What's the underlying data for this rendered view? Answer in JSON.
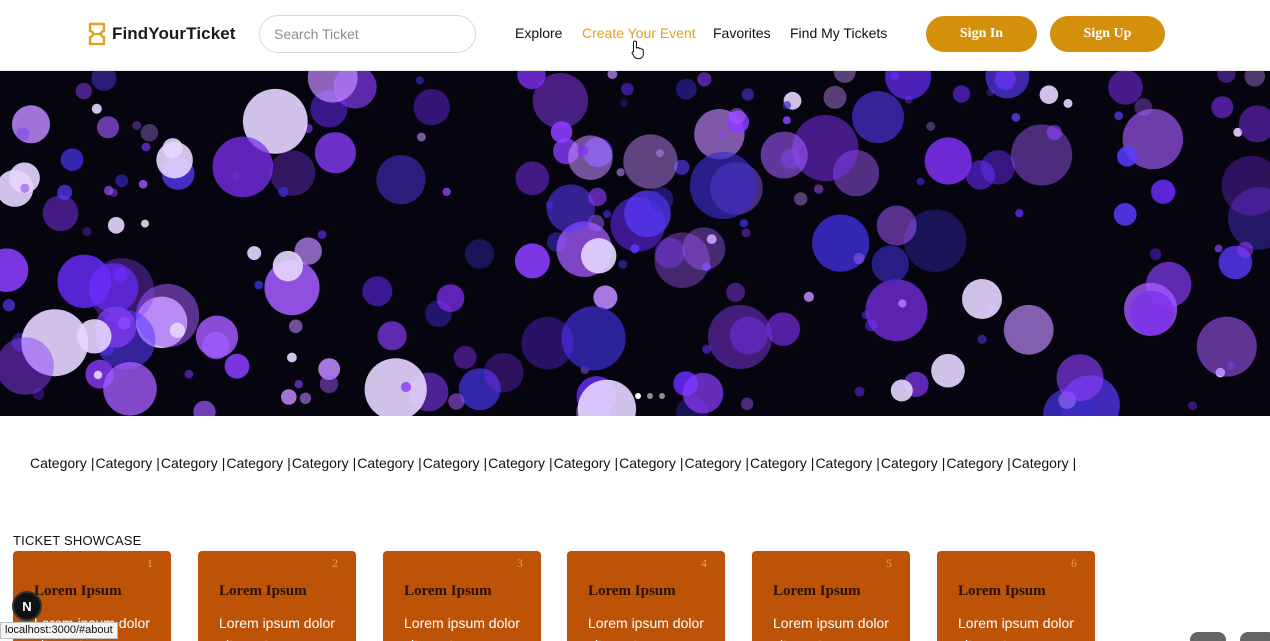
{
  "header": {
    "brand": "FindYourTicket",
    "search_placeholder": "Search Ticket",
    "nav": [
      "Explore",
      "Create Your Event",
      "Favorites",
      "Find My Tickets"
    ],
    "active_nav": "Create Your Event",
    "signin_label": "Sign In",
    "signup_label": "Sign Up"
  },
  "hero": {
    "slides": 3,
    "active_slide": 1
  },
  "categories": {
    "items": [
      "Category",
      "Category",
      "Category",
      "Category",
      "Category",
      "Category",
      "Category",
      "Category",
      "Category",
      "Category",
      "Category",
      "Category",
      "Category",
      "Category",
      "Category",
      "Category"
    ],
    "separator": "|"
  },
  "showcase": {
    "title": "TICKET SHOWCASE",
    "cards": [
      {
        "num": "1",
        "title": "Lorem Ipsum",
        "text": "Lorem ipsum dolor sit amet"
      },
      {
        "num": "2",
        "title": "Lorem Ipsum",
        "text": "Lorem ipsum dolor sit amet"
      },
      {
        "num": "3",
        "title": "Lorem Ipsum",
        "text": "Lorem ipsum dolor sit amet"
      },
      {
        "num": "4",
        "title": "Lorem Ipsum",
        "text": "Lorem ipsum dolor sit amet"
      },
      {
        "num": "5",
        "title": "Lorem Ipsum",
        "text": "Lorem ipsum dolor sit amet"
      },
      {
        "num": "6",
        "title": "Lorem Ipsum",
        "text": "Lorem ipsum dolor sit amet"
      }
    ]
  },
  "overlay": {
    "next_badge": "N",
    "status_url": "localhost:3000/#about"
  },
  "colors": {
    "accent": "#d48f0b",
    "active_nav": "#e0a21a",
    "card_bg": "#bd5307",
    "card_num": "#f0a23a",
    "hero_bg": "#06040e"
  }
}
